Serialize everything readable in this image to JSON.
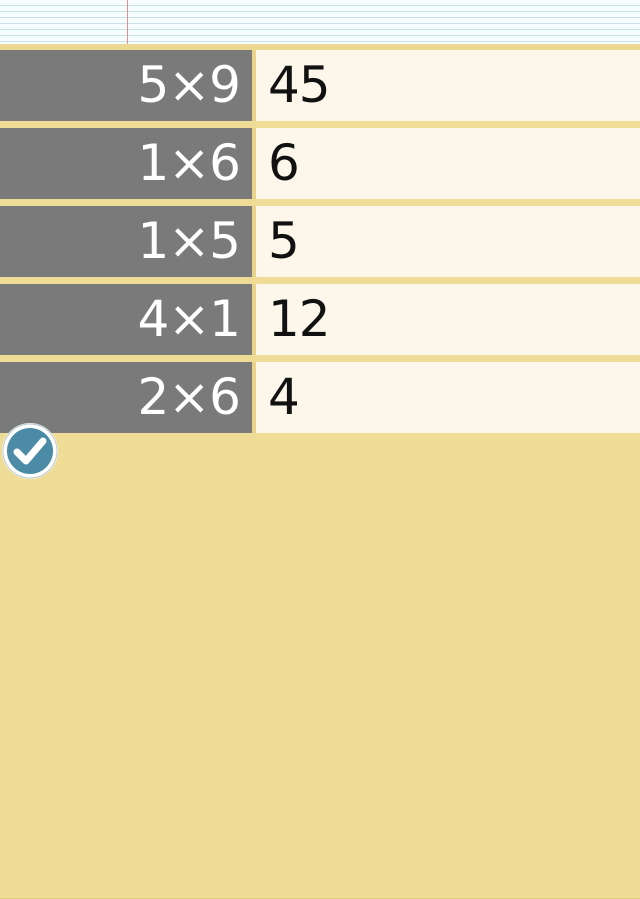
{
  "quiz": {
    "rows": [
      {
        "problem": "5×9",
        "answer": "45"
      },
      {
        "problem": "1×6",
        "answer": "6"
      },
      {
        "problem": "1×5",
        "answer": "5"
      },
      {
        "problem": "4×1",
        "answer": "12"
      },
      {
        "problem": "2×6",
        "answer": "4"
      }
    ]
  },
  "check_button": {
    "icon": "checkmark-icon"
  },
  "colors": {
    "prompt_bg": "#7a7a7a",
    "answer_bg": "#fcf7ea",
    "paper_yellow": "#efdd97",
    "check_blue": "#4b8ba6"
  }
}
